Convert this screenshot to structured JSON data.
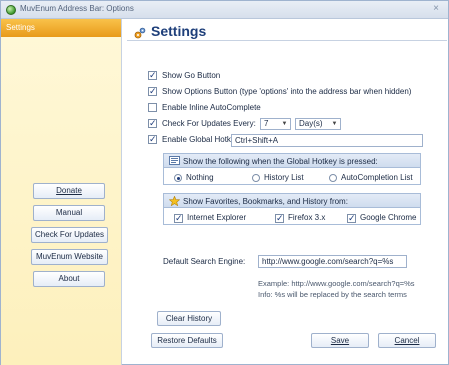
{
  "window": {
    "title": "MuvEnum Address Bar: Options",
    "close_glyph": "×"
  },
  "sidebar": {
    "header": "Settings",
    "buttons": [
      {
        "label": "Donate"
      },
      {
        "label": "Manual"
      },
      {
        "label": "Check For Updates"
      },
      {
        "label": "MuvEnum Website"
      },
      {
        "label": "About"
      }
    ]
  },
  "main": {
    "heading": "Settings",
    "options": {
      "show_go": {
        "label": "Show Go Button",
        "checked": true
      },
      "show_options": {
        "label": "Show Options Button (type 'options' into the address bar when hidden)",
        "checked": true
      },
      "inline_autocomplete": {
        "label": "Enable Inline AutoComplete",
        "checked": false
      },
      "check_updates": {
        "label": "Check For Updates Every:",
        "checked": true,
        "interval_value": "7",
        "interval_unit": "Day(s)"
      },
      "global_hotkey": {
        "label": "Enable Global Hotkey:",
        "checked": true,
        "value": "Ctrl+Shift+A"
      }
    },
    "hotkey_group": {
      "title": "Show the following when the Global Hotkey is pressed:",
      "radios": [
        {
          "label": "Nothing",
          "selected": true
        },
        {
          "label": "History List",
          "selected": false
        },
        {
          "label": "AutoCompletion List",
          "selected": false
        }
      ]
    },
    "sources_group": {
      "title": "Show Favorites, Bookmarks, and History from:",
      "checkboxes": [
        {
          "label": "Internet Explorer",
          "checked": true
        },
        {
          "label": "Firefox 3.x",
          "checked": true
        },
        {
          "label": "Google Chrome",
          "checked": true
        }
      ]
    },
    "search": {
      "label": "Default Search Engine:",
      "value": "http://www.google.com/search?q=%s",
      "example": "Example: http://www.google.com/search?q=%s",
      "info": "Info: %s will be replaced by the search terms"
    },
    "buttons": {
      "clear_history": "Clear History",
      "restore_defaults": "Restore Defaults",
      "save": "Save",
      "cancel": "Cancel"
    }
  },
  "colors": {
    "accent": "#1e3f7a",
    "sidebar_header": "#f0ab2a",
    "sidebar_bg": "#fef4c8"
  }
}
